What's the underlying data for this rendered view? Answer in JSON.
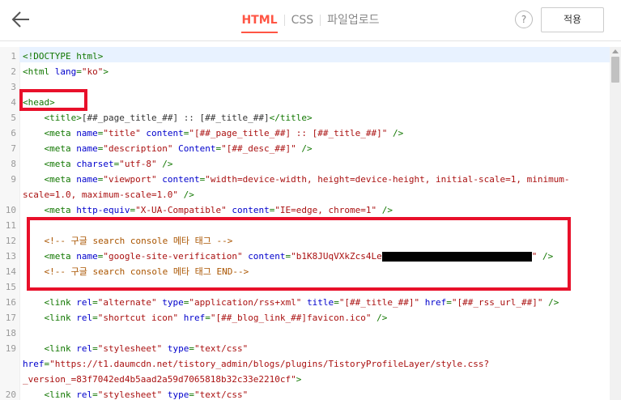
{
  "header": {
    "back_icon": "arrow-left-icon",
    "tabs": [
      {
        "label": "HTML",
        "active": true
      },
      {
        "label": "CSS",
        "active": false
      },
      {
        "label": "파일업로드",
        "active": false
      }
    ],
    "help_label": "?",
    "apply_label": "적용",
    "accent_color": "#ff5544"
  },
  "editor": {
    "lines": [
      {
        "n": "1",
        "segments": [
          [
            "tag",
            "<!DOCTYPE html>"
          ]
        ]
      },
      {
        "n": "2",
        "segments": [
          [
            "tag",
            "<html "
          ],
          [
            "attr",
            "lang"
          ],
          [
            "tag",
            "="
          ],
          [
            "str",
            "\"ko\""
          ],
          [
            "tag",
            ">"
          ]
        ]
      },
      {
        "n": "3",
        "segments": []
      },
      {
        "n": "4",
        "segments": [
          [
            "tag",
            "<head>"
          ]
        ]
      },
      {
        "n": "5",
        "segments": [
          [
            "plain",
            "    "
          ],
          [
            "tag",
            "<title>"
          ],
          [
            "plain",
            "[##_page_title_##] :: [##_title_##]"
          ],
          [
            "tag",
            "</title>"
          ]
        ]
      },
      {
        "n": "6",
        "segments": [
          [
            "plain",
            "    "
          ],
          [
            "tag",
            "<meta "
          ],
          [
            "attr",
            "name"
          ],
          [
            "tag",
            "="
          ],
          [
            "str",
            "\"title\""
          ],
          [
            "plain",
            " "
          ],
          [
            "attr",
            "content"
          ],
          [
            "tag",
            "="
          ],
          [
            "str",
            "\"[##_page_title_##] :: [##_title_##]\""
          ],
          [
            "tag",
            " />"
          ]
        ]
      },
      {
        "n": "7",
        "segments": [
          [
            "plain",
            "    "
          ],
          [
            "tag",
            "<meta "
          ],
          [
            "attr",
            "name"
          ],
          [
            "tag",
            "="
          ],
          [
            "str",
            "\"description\""
          ],
          [
            "plain",
            " "
          ],
          [
            "attr",
            "Content"
          ],
          [
            "tag",
            "="
          ],
          [
            "str",
            "\"[##_desc_##]\""
          ],
          [
            "tag",
            " />"
          ]
        ]
      },
      {
        "n": "8",
        "segments": [
          [
            "plain",
            "    "
          ],
          [
            "tag",
            "<meta "
          ],
          [
            "attr",
            "charset"
          ],
          [
            "tag",
            "="
          ],
          [
            "str",
            "\"utf-8\""
          ],
          [
            "tag",
            " />"
          ]
        ]
      },
      {
        "n": "9",
        "segments": [
          [
            "plain",
            "    "
          ],
          [
            "tag",
            "<meta "
          ],
          [
            "attr",
            "name"
          ],
          [
            "tag",
            "="
          ],
          [
            "str",
            "\"viewport\""
          ],
          [
            "plain",
            " "
          ],
          [
            "attr",
            "content"
          ],
          [
            "tag",
            "="
          ],
          [
            "str",
            "\"width=device-width, height=device-height, initial-scale=1, minimum-"
          ]
        ]
      },
      {
        "n": "",
        "segments": [
          [
            "str",
            "scale=1.0, maximum-scale=1.0\""
          ],
          [
            "tag",
            " />"
          ]
        ]
      },
      {
        "n": "10",
        "segments": [
          [
            "plain",
            "    "
          ],
          [
            "tag",
            "<meta "
          ],
          [
            "attr",
            "http-equiv"
          ],
          [
            "tag",
            "="
          ],
          [
            "str",
            "\"X-UA-Compatible\""
          ],
          [
            "plain",
            " "
          ],
          [
            "attr",
            "content"
          ],
          [
            "tag",
            "="
          ],
          [
            "str",
            "\"IE=edge, chrome=1\""
          ],
          [
            "tag",
            " />"
          ]
        ]
      },
      {
        "n": "11",
        "segments": []
      },
      {
        "n": "12",
        "segments": [
          [
            "plain",
            "    "
          ],
          [
            "comment",
            "<!-- 구글 search console 메타 태그 -->"
          ]
        ]
      },
      {
        "n": "13",
        "segments": [
          [
            "plain",
            "    "
          ],
          [
            "tag",
            "<meta "
          ],
          [
            "attr",
            "name"
          ],
          [
            "tag",
            "="
          ],
          [
            "str",
            "\"google-site-verification\""
          ],
          [
            "plain",
            " "
          ],
          [
            "attr",
            "content"
          ],
          [
            "tag",
            "="
          ],
          [
            "str",
            "\"b1K8JUqVXkZcs4Le"
          ],
          [
            "redact",
            ""
          ],
          [
            "str",
            "\""
          ],
          [
            "tag",
            " />"
          ]
        ]
      },
      {
        "n": "14",
        "segments": [
          [
            "plain",
            "    "
          ],
          [
            "comment",
            "<!-- 구글 search console 메타 태그 END-->"
          ]
        ]
      },
      {
        "n": "15",
        "segments": []
      },
      {
        "n": "16",
        "segments": [
          [
            "plain",
            "    "
          ],
          [
            "tag",
            "<link "
          ],
          [
            "attr",
            "rel"
          ],
          [
            "tag",
            "="
          ],
          [
            "str",
            "\"alternate\""
          ],
          [
            "plain",
            " "
          ],
          [
            "attr",
            "type"
          ],
          [
            "tag",
            "="
          ],
          [
            "str",
            "\"application/rss+xml\""
          ],
          [
            "plain",
            " "
          ],
          [
            "attr",
            "title"
          ],
          [
            "tag",
            "="
          ],
          [
            "str",
            "\"[##_title_##]\""
          ],
          [
            "plain",
            " "
          ],
          [
            "attr",
            "href"
          ],
          [
            "tag",
            "="
          ],
          [
            "str",
            "\"[##_rss_url_##]\""
          ],
          [
            "tag",
            " />"
          ]
        ]
      },
      {
        "n": "17",
        "segments": [
          [
            "plain",
            "    "
          ],
          [
            "tag",
            "<link "
          ],
          [
            "attr",
            "rel"
          ],
          [
            "tag",
            "="
          ],
          [
            "str",
            "\"shortcut icon\""
          ],
          [
            "plain",
            " "
          ],
          [
            "attr",
            "href"
          ],
          [
            "tag",
            "="
          ],
          [
            "str",
            "\"[##_blog_link_##]favicon.ico\""
          ],
          [
            "tag",
            " />"
          ]
        ]
      },
      {
        "n": "18",
        "segments": []
      },
      {
        "n": "19",
        "segments": [
          [
            "plain",
            "    "
          ],
          [
            "tag",
            "<link "
          ],
          [
            "attr",
            "rel"
          ],
          [
            "tag",
            "="
          ],
          [
            "str",
            "\"stylesheet\""
          ],
          [
            "plain",
            " "
          ],
          [
            "attr",
            "type"
          ],
          [
            "tag",
            "="
          ],
          [
            "str",
            "\"text/css\""
          ]
        ]
      },
      {
        "n": "",
        "segments": [
          [
            "attr",
            "href"
          ],
          [
            "tag",
            "="
          ],
          [
            "str",
            "\"https://t1.daumcdn.net/tistory_admin/blogs/plugins/TistoryProfileLayer/style.css?"
          ]
        ]
      },
      {
        "n": "",
        "segments": [
          [
            "str",
            "_version_=83f7042ed4b5aad2a59d7065818b32c33e2210cf\""
          ],
          [
            "tag",
            ">"
          ]
        ]
      },
      {
        "n": "20",
        "segments": [
          [
            "plain",
            "    "
          ],
          [
            "tag",
            "<link "
          ],
          [
            "attr",
            "rel"
          ],
          [
            "tag",
            "="
          ],
          [
            "str",
            "\"stylesheet\""
          ],
          [
            "plain",
            " "
          ],
          [
            "attr",
            "type"
          ],
          [
            "tag",
            "="
          ],
          [
            "str",
            "\"text/css\""
          ]
        ]
      }
    ]
  },
  "colors": {
    "highlight_box": "#e8102a",
    "tag": "#117700",
    "attr": "#0000cc",
    "string": "#aa1111",
    "comment": "#aa5500"
  }
}
